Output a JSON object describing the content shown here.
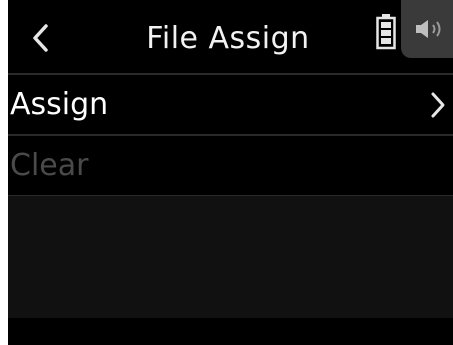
{
  "header": {
    "title": "File Assign",
    "back_icon": "chevron-left-icon",
    "battery_icon": "battery-icon",
    "speaker_icon": "speaker-icon"
  },
  "menu": {
    "items": [
      {
        "label": "Assign",
        "enabled": true,
        "has_submenu": true
      },
      {
        "label": "Clear",
        "enabled": false,
        "has_submenu": false
      }
    ]
  },
  "colors": {
    "background": "#000000",
    "text": "#ffffff",
    "disabled_text": "#4a4a4a",
    "speaker_tab": "#3a3a3a"
  }
}
